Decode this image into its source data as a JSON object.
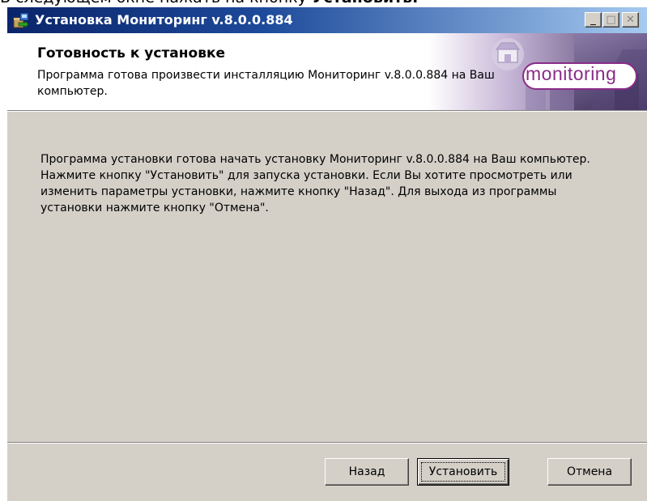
{
  "caption": {
    "prefix": "В следующем окне нажать на кнопку ",
    "bold": "Установить."
  },
  "window": {
    "title": "Установка Мониторинг v.8.0.0.884",
    "controls": {
      "minimize": "_",
      "maximize": "□",
      "close": "✕"
    }
  },
  "banner": {
    "title": "Готовность к установке",
    "description": "Программа готова произвести инсталляцию Мониторинг v.8.0.0.884 на Ваш компьютер.",
    "logo": "monitoring"
  },
  "body": {
    "text": "Программа установки готова начать установку Мониторинг v.8.0.0.884 на Ваш компьютер. Нажмите кнопку \"Установить\" для запуска установки. Если Вы хотите просмотреть или изменить параметры установки, нажмите кнопку \"Назад\". Для выхода из программы установки нажмите кнопку \"Отмена\"."
  },
  "buttons": {
    "back": "Назад",
    "install": "Установить",
    "cancel": "Отмена"
  },
  "colors": {
    "titlebar_start": "#0a246a",
    "titlebar_end": "#a6caf0",
    "dialog_bg": "#d4d0c8",
    "logo_accent": "#8a2b88"
  },
  "icons": {
    "app": "installer-package-icon",
    "banner": "store-building-icon"
  }
}
